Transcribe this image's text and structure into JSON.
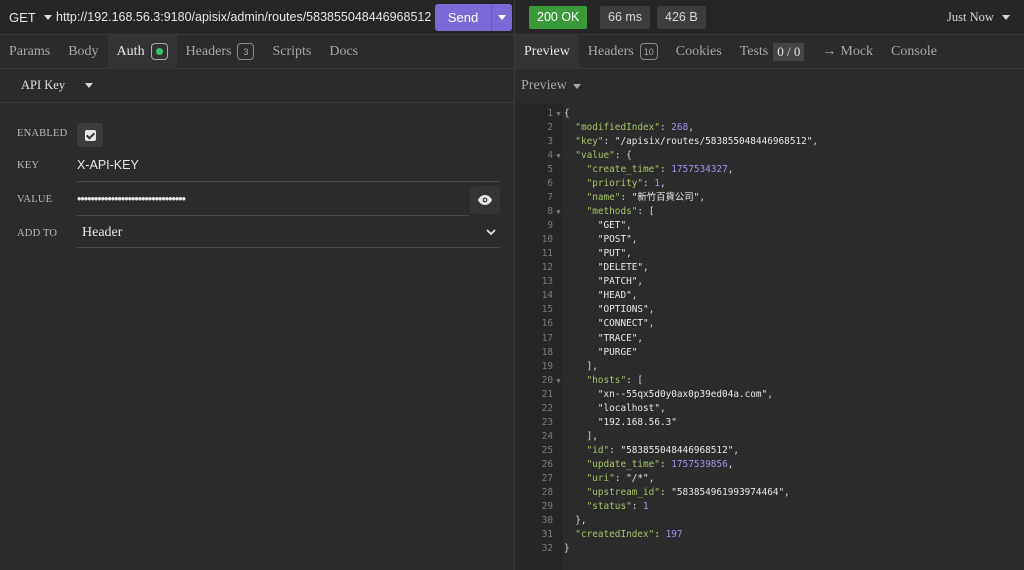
{
  "request": {
    "method": "GET",
    "url": "http://192.168.56.3:9180/apisix/admin/routes/583855048446968512",
    "send_label": "Send"
  },
  "response_meta": {
    "status": "200 OK",
    "time": "66 ms",
    "size": "426 B",
    "history_label": "Just Now"
  },
  "request_tabs": [
    {
      "label": "Params"
    },
    {
      "label": "Body"
    },
    {
      "label": "Auth"
    },
    {
      "label": "Headers",
      "count": "3"
    },
    {
      "label": "Scripts"
    },
    {
      "label": "Docs"
    }
  ],
  "response_tabs": [
    {
      "label": "Preview"
    },
    {
      "label": "Headers",
      "count": "10"
    },
    {
      "label": "Cookies"
    },
    {
      "label": "Tests",
      "score": "0 / 0"
    },
    {
      "label": "Mock",
      "arrow": "→"
    },
    {
      "label": "Console"
    }
  ],
  "auth": {
    "type": "API Key",
    "enabled_label": "ENABLED",
    "enabled": true,
    "key_label": "KEY",
    "key_value": "X-API-KEY",
    "value_label": "VALUE",
    "value_masked": "••••••••••••••••••••••••••••••••",
    "add_to_label": "ADD TO",
    "add_to_value": "Header"
  },
  "preview": {
    "mode_label": "Preview",
    "lines": [
      {
        "n": "1",
        "fold": true,
        "text": "{"
      },
      {
        "n": "2",
        "text": "  \"modifiedIndex\": 268,"
      },
      {
        "n": "3",
        "text": "  \"key\": \"/apisix/routes/583855048446968512\","
      },
      {
        "n": "4",
        "fold": true,
        "text": "  \"value\": {"
      },
      {
        "n": "5",
        "text": "    \"create_time\": 1757534327,"
      },
      {
        "n": "6",
        "text": "    \"priority\": 1,"
      },
      {
        "n": "7",
        "text": "    \"name\": \"新竹百貨公司\","
      },
      {
        "n": "8",
        "fold": true,
        "text": "    \"methods\": ["
      },
      {
        "n": "9",
        "text": "      \"GET\","
      },
      {
        "n": "10",
        "text": "      \"POST\","
      },
      {
        "n": "11",
        "text": "      \"PUT\","
      },
      {
        "n": "12",
        "text": "      \"DELETE\","
      },
      {
        "n": "13",
        "text": "      \"PATCH\","
      },
      {
        "n": "14",
        "text": "      \"HEAD\","
      },
      {
        "n": "15",
        "text": "      \"OPTIONS\","
      },
      {
        "n": "16",
        "text": "      \"CONNECT\","
      },
      {
        "n": "17",
        "text": "      \"TRACE\","
      },
      {
        "n": "18",
        "text": "      \"PURGE\""
      },
      {
        "n": "19",
        "text": "    ],"
      },
      {
        "n": "20",
        "fold": true,
        "text": "    \"hosts\": ["
      },
      {
        "n": "21",
        "text": "      \"xn--55qx5d0y0ax0p39ed04a.com\","
      },
      {
        "n": "22",
        "text": "      \"localhost\","
      },
      {
        "n": "23",
        "text": "      \"192.168.56.3\""
      },
      {
        "n": "24",
        "text": "    ],"
      },
      {
        "n": "25",
        "text": "    \"id\": \"583855048446968512\","
      },
      {
        "n": "26",
        "text": "    \"update_time\": 1757539856,"
      },
      {
        "n": "27",
        "text": "    \"uri\": \"/*\","
      },
      {
        "n": "28",
        "text": "    \"upstream_id\": \"583854961993974464\","
      },
      {
        "n": "29",
        "text": "    \"status\": 1"
      },
      {
        "n": "30",
        "text": "  },"
      },
      {
        "n": "31",
        "text": "  \"createdIndex\": 197"
      },
      {
        "n": "32",
        "text": "}"
      }
    ]
  },
  "colors": {
    "accent": "#7b6ad6",
    "status_ok": "#3a9a3a",
    "json_key": "#a4c56a",
    "json_number": "#a890f0",
    "enabled_dot": "#35c46a"
  }
}
